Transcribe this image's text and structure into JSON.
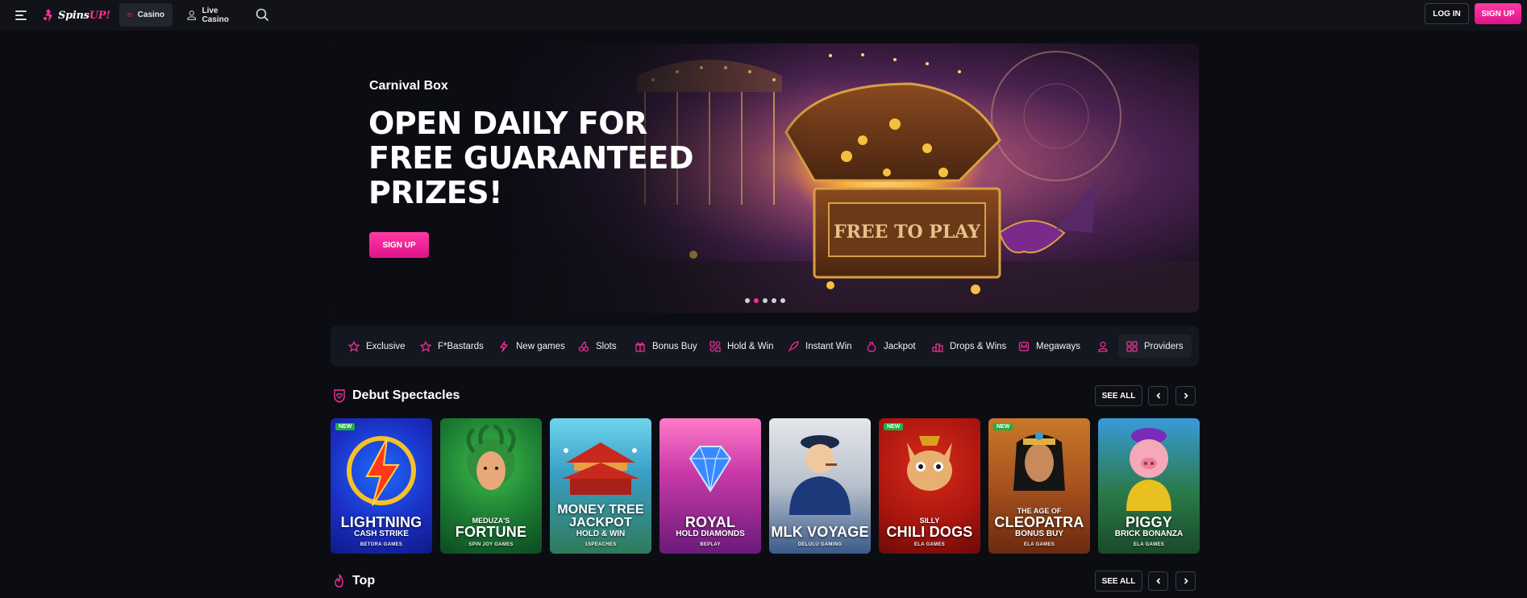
{
  "brand": {
    "name_part1": "Spins",
    "name_part2": "UP!",
    "accent": "#ff2d9b"
  },
  "nav": {
    "menu_icon": "hamburger-icon",
    "tabs": [
      {
        "label": "Casino",
        "icon": "casino-icon",
        "active": true
      },
      {
        "label": "Live Casino",
        "icon": "dealer-icon",
        "active": false
      }
    ],
    "search_icon": "search-icon"
  },
  "auth": {
    "login_label": "LOG IN",
    "signup_label": "SIGN UP"
  },
  "hero": {
    "kicker": "Carnival Box",
    "title": "OPEN DAILY FOR FREE GUARANTEED PRIZES!",
    "cta_label": "SIGN UP",
    "chest_text": "FREE TO PLAY",
    "slides_count": 5,
    "active_slide": 2
  },
  "categories": [
    {
      "label": "Exclusive",
      "icon": "star-icon"
    },
    {
      "label": "F*Bastards",
      "icon": "star-outline-icon"
    },
    {
      "label": "New games",
      "icon": "lightning-icon"
    },
    {
      "label": "Slots",
      "icon": "cherries-icon"
    },
    {
      "label": "Bonus Buy",
      "icon": "gift-icon"
    },
    {
      "label": "Hold & Win",
      "icon": "coins-icon"
    },
    {
      "label": "Instant Win",
      "icon": "rocket-icon"
    },
    {
      "label": "Jackpot",
      "icon": "moneybag-icon"
    },
    {
      "label": "Drops & Wins",
      "icon": "podium-icon"
    },
    {
      "label": "Megaways",
      "icon": "megaways-icon"
    },
    {
      "label": "",
      "icon": "dealer-icon"
    },
    {
      "label": "Providers",
      "icon": "grid-icon"
    }
  ],
  "sections": [
    {
      "title": "Debut Spectacles",
      "icon": "heart-shield-icon",
      "see_all": "SEE ALL"
    },
    {
      "title": "Top",
      "icon": "flame-icon",
      "see_all": "SEE ALL"
    }
  ],
  "games": [
    {
      "badge": "NEW",
      "line1": "",
      "line2": "LIGHTNING",
      "line3": "CASH STRIKE",
      "provider": "BETORA GAMES"
    },
    {
      "badge": "",
      "line1": "MEDUZA'S",
      "line2": "FORTUNE",
      "line3": "",
      "provider": "SPIN JOY GAMES"
    },
    {
      "badge": "",
      "line1": "",
      "line2": "MONEY TREE JACKPOT",
      "line3": "HOLD & WIN",
      "provider": "1SPEACHES"
    },
    {
      "badge": "",
      "line1": "",
      "line2": "ROYAL",
      "line3": "HOLD DIAMONDS",
      "provider": "BEPLAY"
    },
    {
      "badge": "",
      "line1": "",
      "line2": "MLK VOYAGE",
      "line3": "",
      "provider": "DELULU GAMING"
    },
    {
      "badge": "NEW",
      "line1": "SILLY",
      "line2": "CHILI DOGS",
      "line3": "",
      "provider": "ELA GAMES"
    },
    {
      "badge": "NEW",
      "line1": "THE AGE OF",
      "line2": "CLEOPATRA",
      "line3": "BONUS BUY",
      "provider": "ELA GAMES"
    },
    {
      "badge": "",
      "line1": "",
      "line2": "PIGGY",
      "line3": "BRICK BONANZA",
      "provider": "ELA GAMES"
    }
  ]
}
